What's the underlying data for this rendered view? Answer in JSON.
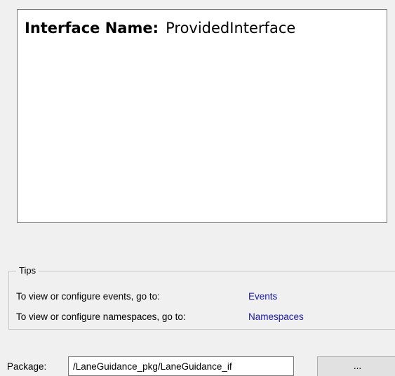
{
  "info_panel": {
    "label": "Interface Name:",
    "value": "ProvidedInterface"
  },
  "tips": {
    "legend": "Tips",
    "rows": [
      {
        "text": "To view or configure events, go to:",
        "link": "Events"
      },
      {
        "text": "To view or configure namespaces, go to:",
        "link": "Namespaces"
      }
    ]
  },
  "package": {
    "label": "Package:",
    "value": "/LaneGuidance_pkg/LaneGuidance_if",
    "browse_label": "..."
  },
  "colors": {
    "background": "#f0f0f0",
    "panel": "#ffffff",
    "link": "#1a1aa6"
  }
}
